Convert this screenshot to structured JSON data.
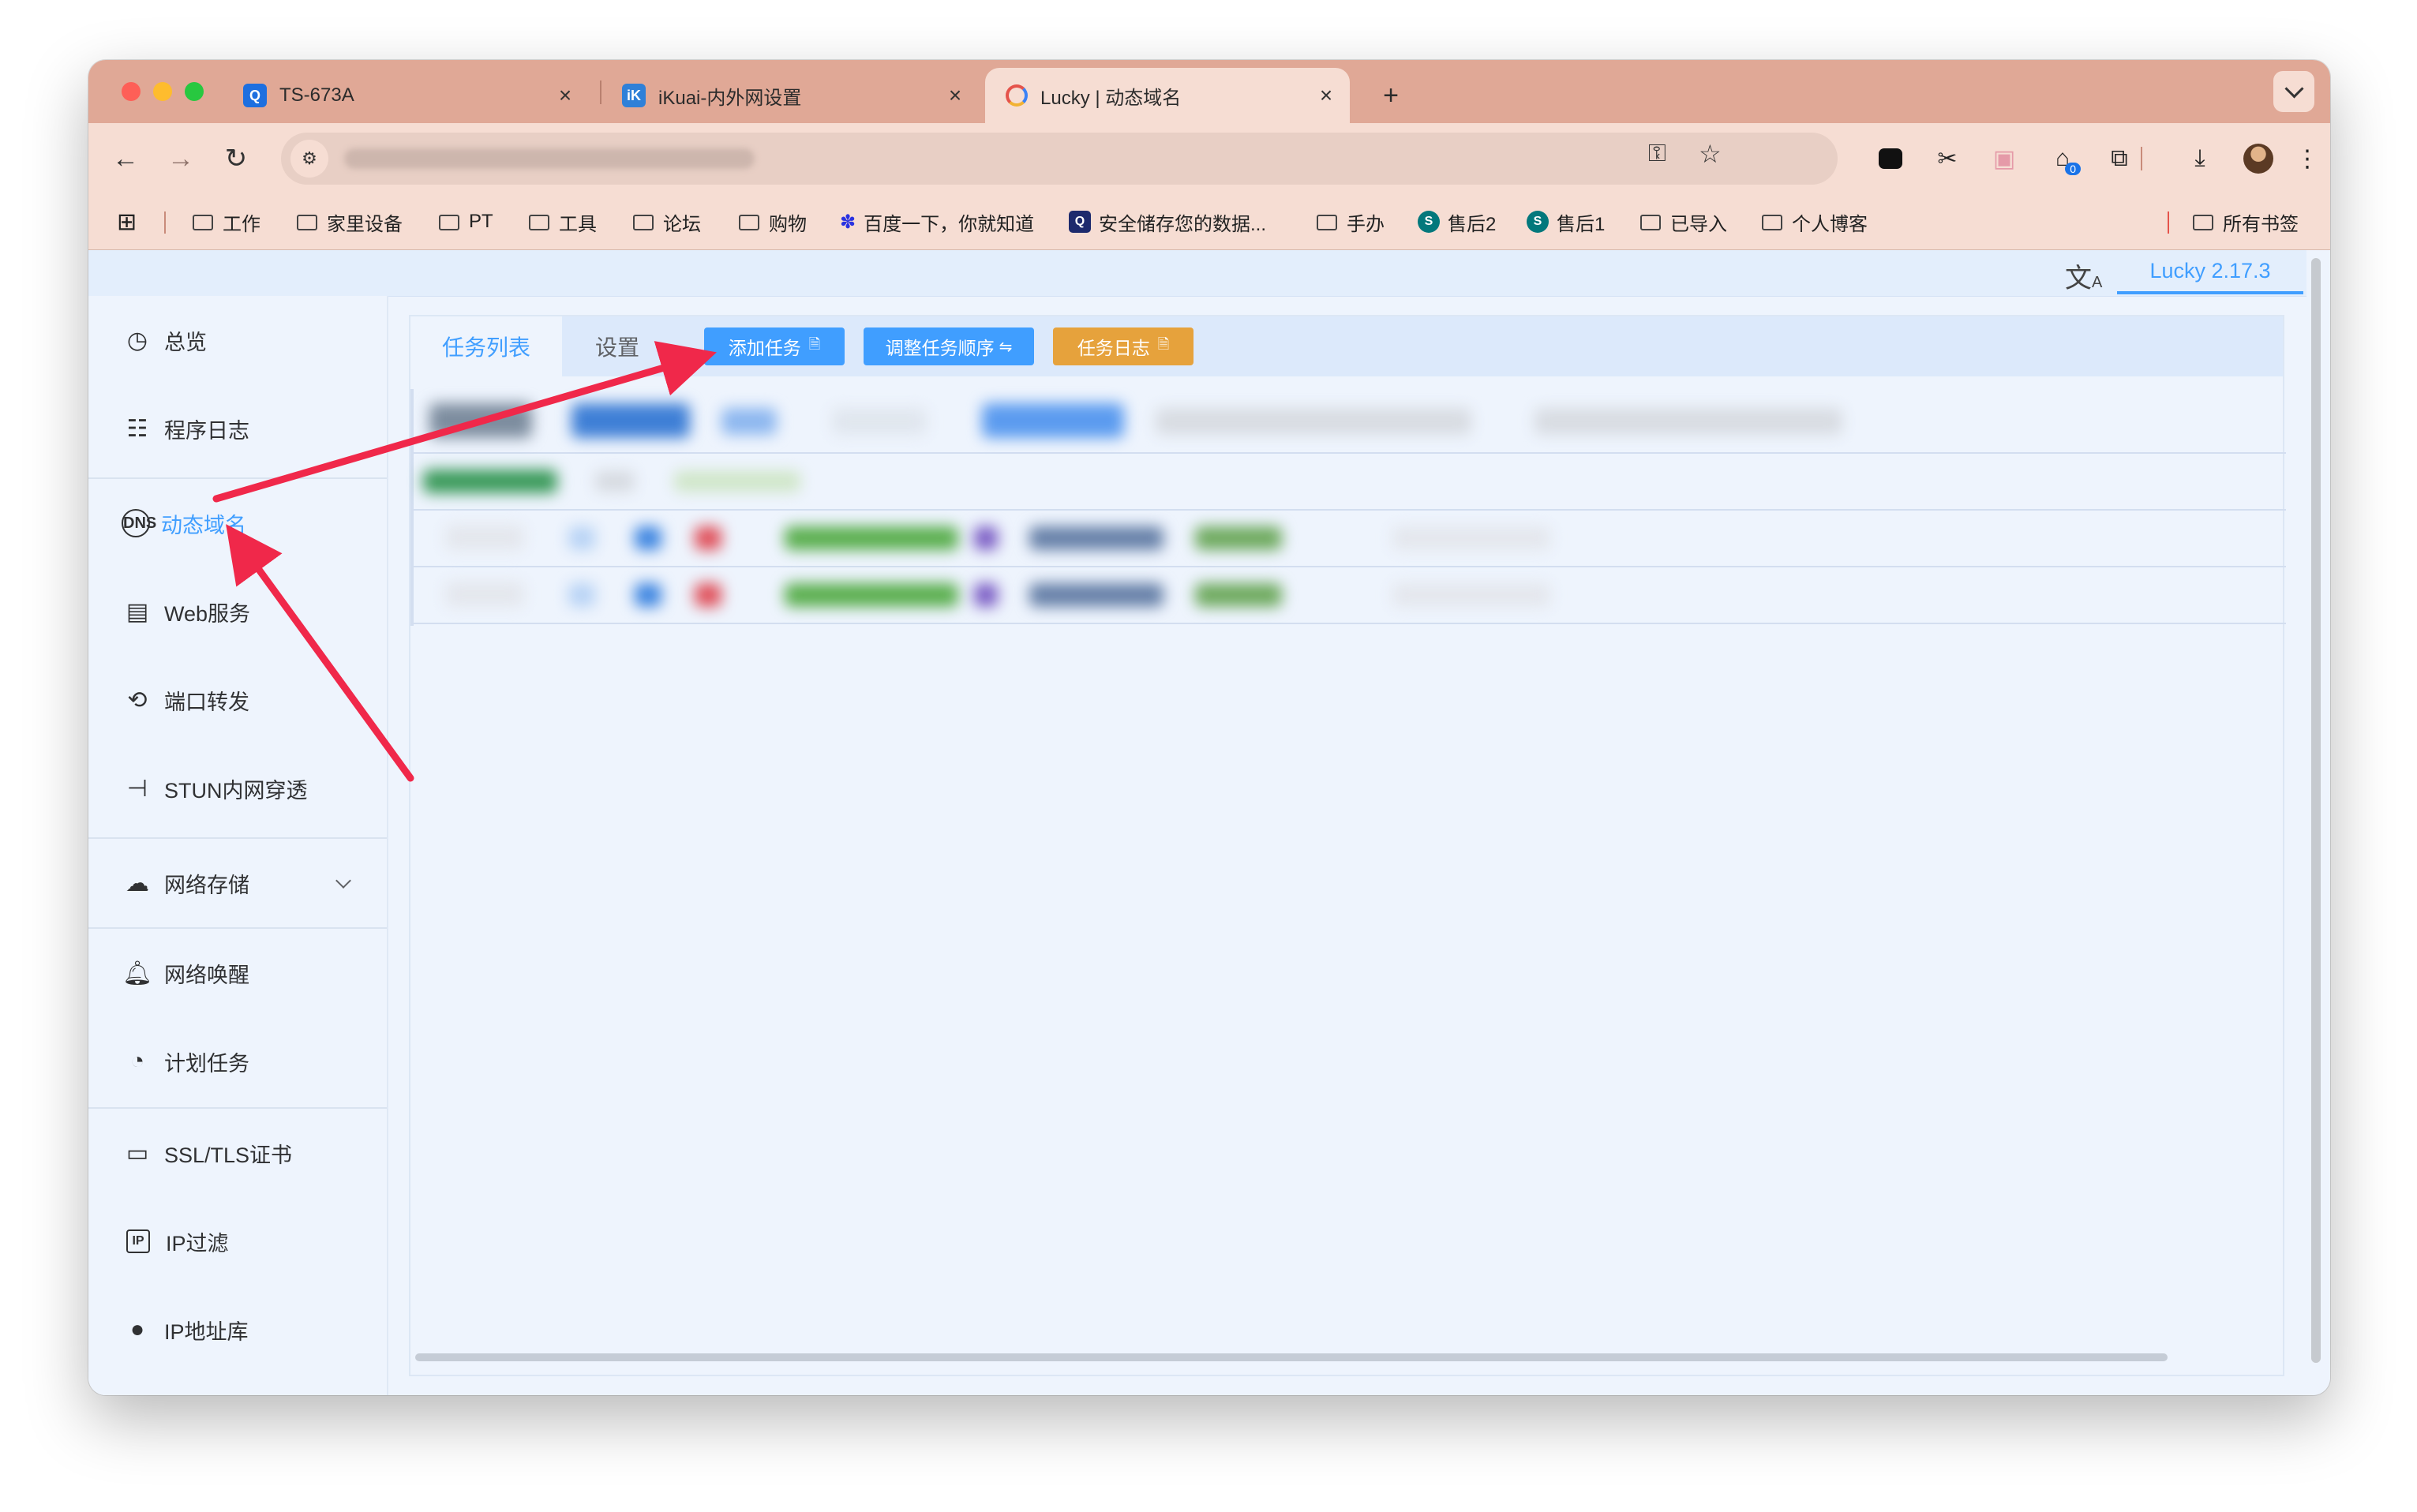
{
  "browser": {
    "tabs": [
      {
        "title": "TS-673A",
        "icon": "qnap-icon"
      },
      {
        "title": "iKuai-内外网设置",
        "icon": "ikuai-icon"
      },
      {
        "title": "Lucky | 动态域名",
        "icon": "lucky-icon"
      }
    ],
    "new_tab": "+",
    "bookmarks": [
      "工作",
      "家里设备",
      "PT",
      "工具",
      "论坛",
      "购物",
      "百度一下，你就知道",
      "安全储存您的数据...",
      "手办",
      "售后2",
      "售后1",
      "已导入",
      "个人博客"
    ],
    "all_bookmarks": "所有书签",
    "extension_badge": "0"
  },
  "app": {
    "version": "Lucky 2.17.3",
    "translate_icon": "translate-icon",
    "sidebar": [
      {
        "label": "总览",
        "icon": "dashboard-icon"
      },
      {
        "label": "程序日志",
        "icon": "log-icon"
      },
      {
        "label": "动态域名",
        "icon": "dns-icon",
        "active": true
      },
      {
        "label": "Web服务",
        "icon": "web-icon"
      },
      {
        "label": "端口转发",
        "icon": "port-forward-icon"
      },
      {
        "label": "STUN内网穿透",
        "icon": "stun-icon"
      },
      {
        "label": "网络存储",
        "icon": "cloud-icon"
      },
      {
        "label": "网络唤醒",
        "icon": "bell-icon"
      },
      {
        "label": "计划任务",
        "icon": "clock-icon"
      },
      {
        "label": "SSL/TLS证书",
        "icon": "certificate-icon"
      },
      {
        "label": "IP过滤",
        "icon": "ip-filter-icon"
      },
      {
        "label": "IP地址库",
        "icon": "ip-db-icon"
      }
    ],
    "tabs": [
      "任务列表",
      "设置"
    ],
    "buttons": {
      "add_task": "添加任务",
      "reorder": "调整任务顺序",
      "task_log": "任务日志"
    },
    "colors": {
      "primary": "#409eff",
      "warning": "#e6a23c",
      "annotation": "#f0284a"
    }
  }
}
